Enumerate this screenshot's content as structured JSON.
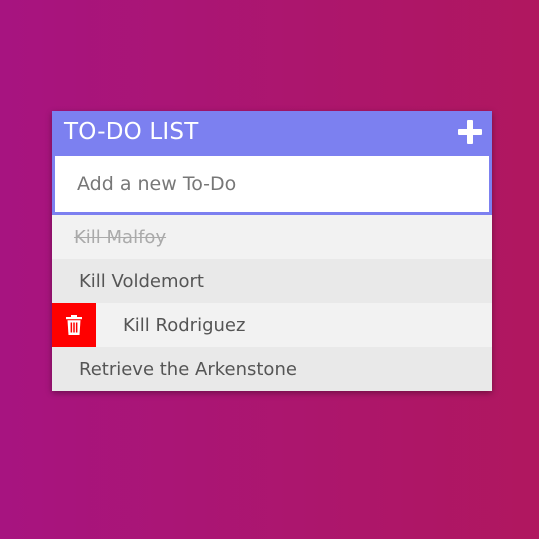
{
  "app": {
    "title": "TO-DO LIST"
  },
  "input": {
    "placeholder": "Add a new To-Do",
    "value": ""
  },
  "todos": [
    {
      "text": "Kill Malfoy",
      "completed": true
    },
    {
      "text": "Kill Voldemort",
      "completed": false
    },
    {
      "text": "Kill Rodriguez",
      "completed": false,
      "delete_revealed": true
    },
    {
      "text": "Retrieve the Arkenstone",
      "completed": false
    }
  ],
  "colors": {
    "header": "#7c80f0",
    "delete": "#ff0000",
    "background_start": "#a71480",
    "background_end": "#b0175f"
  },
  "icons": {
    "add": "plus-icon",
    "delete": "trash-icon"
  }
}
